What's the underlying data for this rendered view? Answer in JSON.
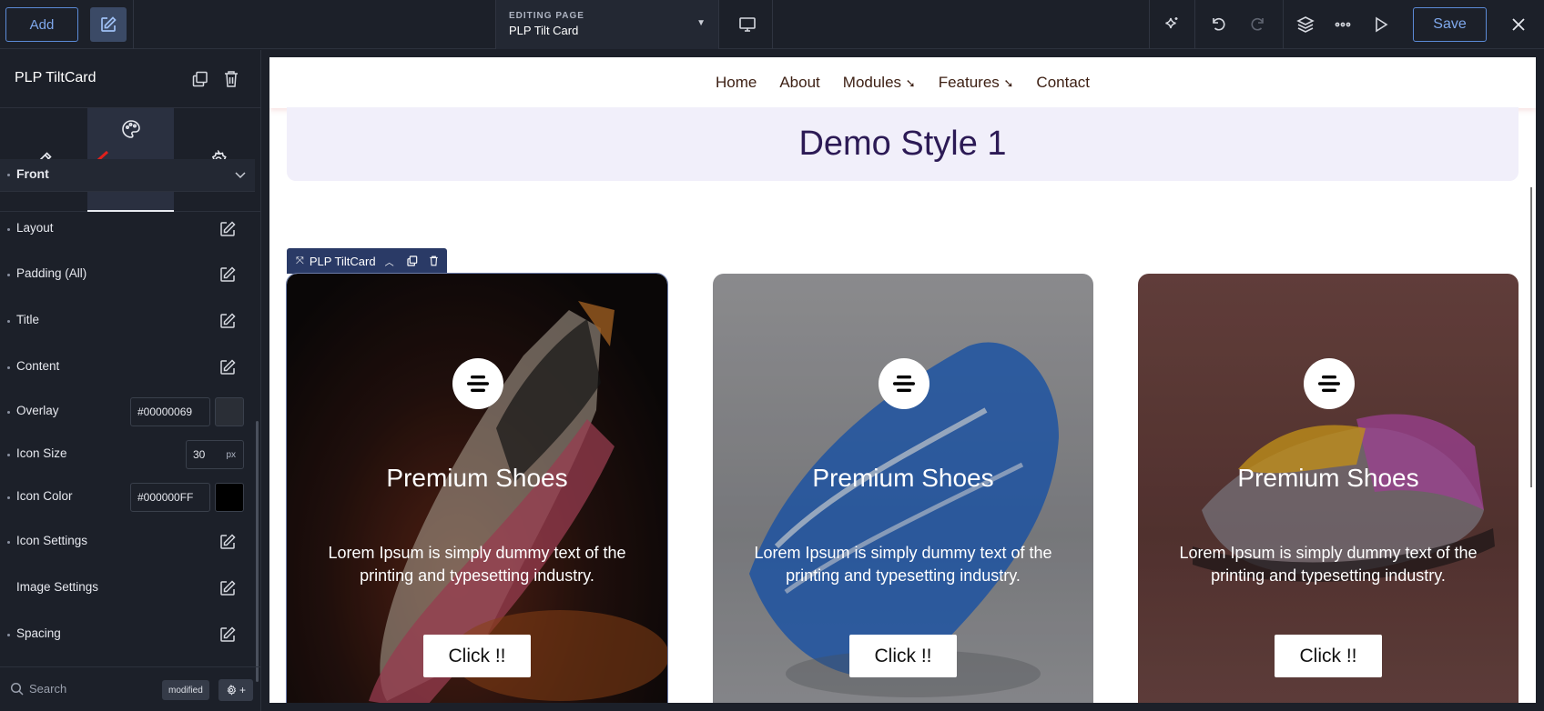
{
  "topbar": {
    "add_label": "Add",
    "editing_caption": "EDITING PAGE",
    "page_name": "PLP Tilt Card",
    "save_label": "Save"
  },
  "sidebar": {
    "title": "PLP TiltCard",
    "section": "Front",
    "props": [
      {
        "label": "Layout"
      },
      {
        "label": "Padding (All)"
      },
      {
        "label": "Title"
      },
      {
        "label": "Content"
      },
      {
        "label": "Overlay",
        "value": "#00000069"
      },
      {
        "label": "Icon Size",
        "value": "30",
        "unit": "px"
      },
      {
        "label": "Icon Color",
        "value": "#000000FF"
      },
      {
        "label": "Icon Settings"
      },
      {
        "label": "Image Settings"
      },
      {
        "label": "Spacing"
      }
    ],
    "search_placeholder": "Search",
    "modified_badge": "modified"
  },
  "canvas": {
    "nav": [
      "Home",
      "About",
      "Modules",
      "Features",
      "Contact"
    ],
    "hero_title": "Demo Style 1",
    "selection_label": "PLP TiltCard",
    "cards": [
      {
        "title": "Premium Shoes",
        "desc": "Lorem Ipsum is simply dummy text of the printing and typesetting industry.",
        "button": "Click !!"
      },
      {
        "title": "Premium Shoes",
        "desc": "Lorem Ipsum is simply dummy text of the printing and typesetting industry.",
        "button": "Click !!"
      },
      {
        "title": "Premium Shoes",
        "desc": "Lorem Ipsum is simply dummy text of the printing and typesetting industry.",
        "button": "Click !!"
      }
    ]
  },
  "colors": {
    "accent": "#5b8ad6",
    "panel_bg": "#1c2029",
    "hero_text": "#2c1a55",
    "nav_text": "#3d2014"
  }
}
